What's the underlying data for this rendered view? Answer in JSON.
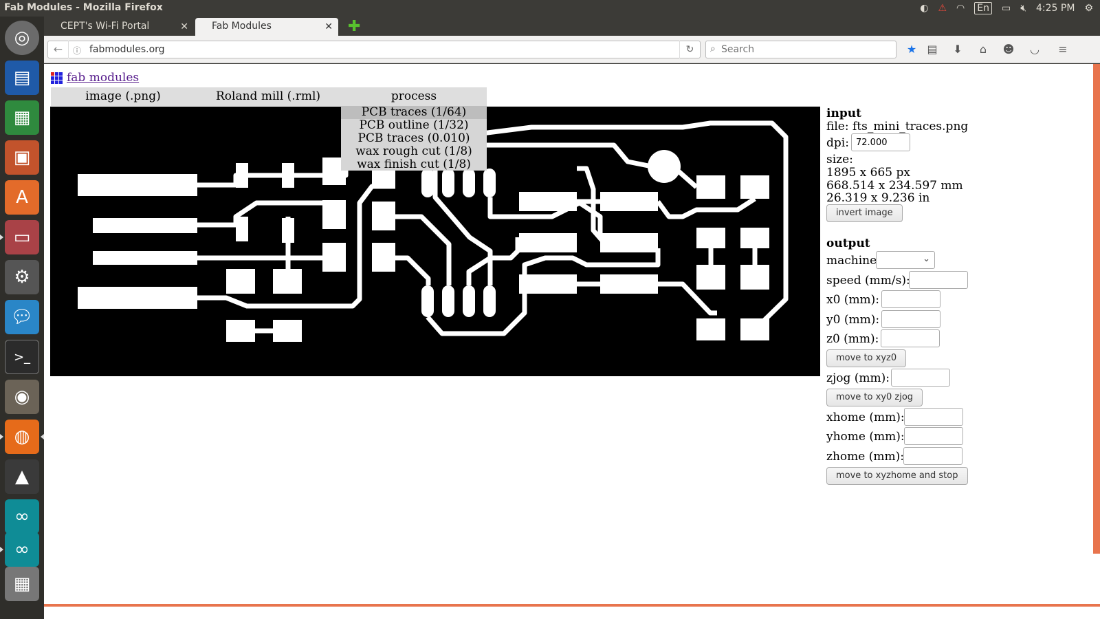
{
  "window": {
    "title": "Fab Modules - Mozilla Firefox",
    "clock": "4:25 PM",
    "keyboard": "En"
  },
  "tabs": [
    {
      "label": "CEPT's Wi-Fi Portal"
    },
    {
      "label": "Fab Modules"
    }
  ],
  "nav": {
    "url": "fabmodules.org",
    "search_placeholder": "Search"
  },
  "page": {
    "home_link": "fab modules",
    "menu": [
      "image (.png)",
      "Roland mill (.rml)",
      "process"
    ],
    "process_options": [
      "PCB traces (1/64)",
      "PCB outline (1/32)",
      "PCB traces (0.010)",
      "wax rough cut (1/8)",
      "wax finish cut (1/8)"
    ],
    "selected_process": "PCB traces (1/64)"
  },
  "input": {
    "heading": "input",
    "file": "file: fts_mini_traces.png",
    "dpi_label": "dpi:",
    "dpi_value": "72.000",
    "size_label": "size:",
    "size_px": "1895 x 665 px",
    "size_mm": "668.514 x 234.597 mm",
    "size_in": "26.319 x 9.236 in",
    "invert_button": "invert image"
  },
  "output": {
    "heading": "output",
    "machine_label": "machine",
    "speed_label": "speed (mm/s):",
    "x0_label": "x0 (mm):",
    "y0_label": "y0 (mm):",
    "z0_label": "z0 (mm):",
    "move_xyz0_button": "move to xyz0",
    "zjog_label": "zjog (mm):",
    "move_xy0zjog_button": "move to xy0 zjog",
    "xhome_label": "xhome (mm):",
    "yhome_label": "yhome (mm):",
    "zhome_label": "zhome (mm):",
    "move_home_button": "move to xyzhome and stop"
  },
  "colors": {
    "accent": "#e8744d",
    "firefox_blue": "#1a73e8"
  }
}
